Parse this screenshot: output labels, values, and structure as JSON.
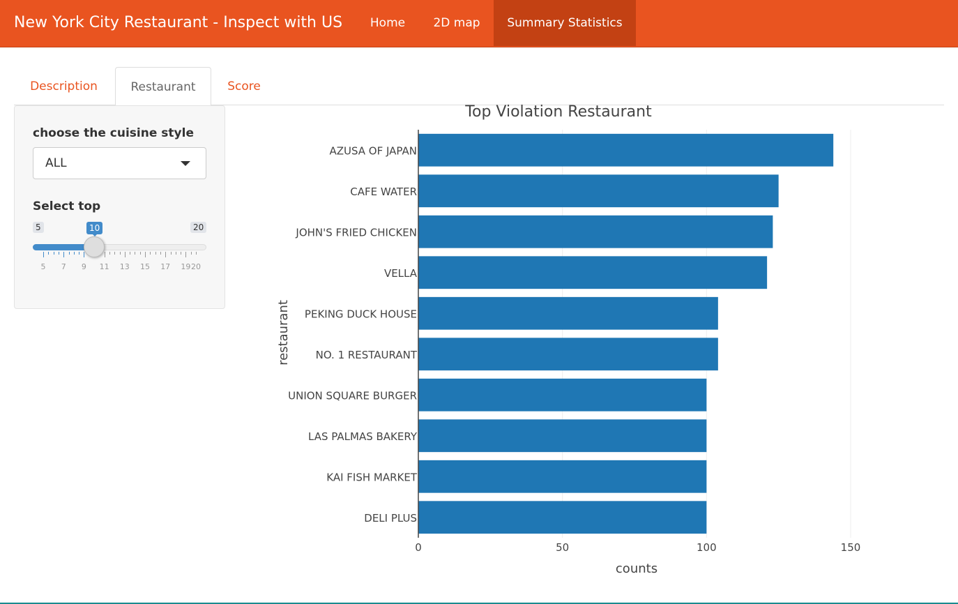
{
  "navbar": {
    "brand": "New York City Restaurant - Inspect with US",
    "items": [
      {
        "label": "Home",
        "active": false
      },
      {
        "label": "2D map",
        "active": false
      },
      {
        "label": "Summary Statistics",
        "active": true
      }
    ]
  },
  "tabs": [
    {
      "label": "Description",
      "active": false
    },
    {
      "label": "Restaurant",
      "active": true
    },
    {
      "label": "Score",
      "active": false
    }
  ],
  "sidebar": {
    "cuisine_label": "choose the cuisine style",
    "cuisine_value": "ALL",
    "slider_label": "Select top",
    "slider": {
      "min": 5,
      "max": 20,
      "value": 10,
      "min_label": "5",
      "max_label": "20",
      "value_label": "10",
      "grid_labels": [
        "5",
        "7",
        "9",
        "11",
        "13",
        "15",
        "17",
        "19",
        "20"
      ]
    }
  },
  "colors": {
    "accent": "#e95420",
    "bar": "#1f77b4",
    "slider": "#428bca"
  },
  "chart_data": {
    "type": "bar",
    "orientation": "horizontal",
    "title": "Top Violation Restaurant",
    "xlabel": "counts",
    "ylabel": "restaurant",
    "categories": [
      "AZUSA OF JAPAN",
      "CAFE WATER",
      "JOHN'S FRIED CHICKEN",
      "VELLA",
      "PEKING DUCK HOUSE",
      "NO. 1 RESTAURANT",
      "UNION SQUARE BURGER",
      "LAS PALMAS BAKERY",
      "KAI FISH MARKET",
      "DELI PLUS"
    ],
    "values": [
      144,
      125,
      123,
      121,
      104,
      104,
      100,
      100,
      100,
      100
    ],
    "xlim": [
      0,
      175
    ],
    "xticks": [
      0,
      50,
      100,
      150
    ],
    "grid": true
  }
}
